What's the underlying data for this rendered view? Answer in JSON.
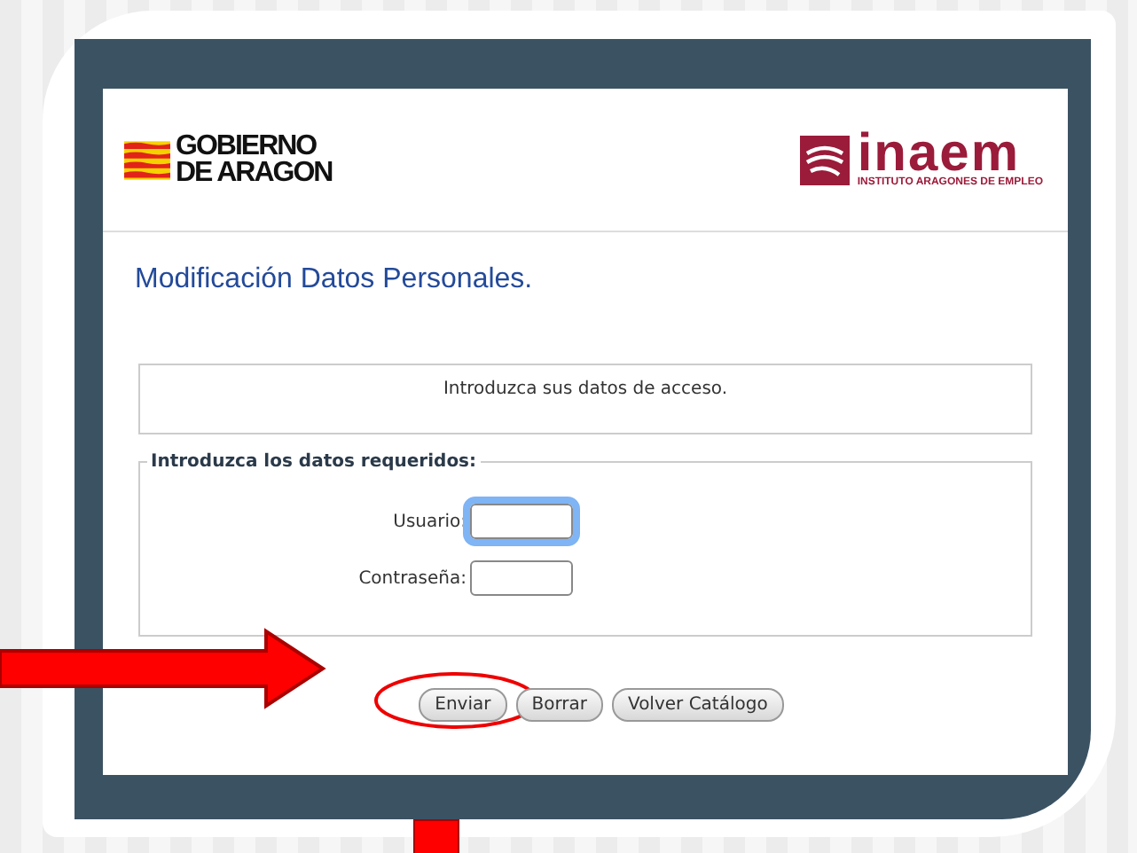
{
  "header": {
    "left_logo": {
      "line_1": "GOBIERNO",
      "line_2": "DE ARAGON"
    },
    "right_logo": {
      "name": "inaem",
      "subtitle": "INSTITUTO ARAGONES DE EMPLEO"
    }
  },
  "page_title": "Modificación Datos Personales.",
  "message": "Introduzca sus datos de acceso.",
  "form": {
    "legend": "Introduzca los datos requeridos:",
    "fields": [
      {
        "label": "Usuario:",
        "focused": true
      },
      {
        "label": "Contraseña:",
        "focused": false
      }
    ]
  },
  "buttons": [
    {
      "label": "Enviar",
      "highlighted": true
    },
    {
      "label": "Borrar",
      "highlighted": false
    },
    {
      "label": "Volver Catálogo",
      "highlighted": false
    }
  ]
}
